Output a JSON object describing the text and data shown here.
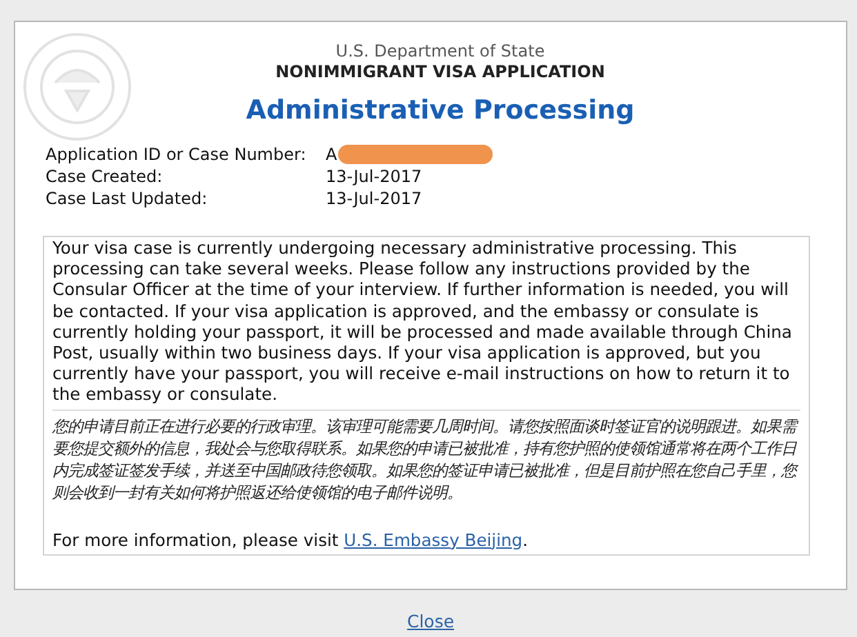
{
  "header": {
    "agency": "U.S. Department of State",
    "form": "NONIMMIGRANT VISA APPLICATION",
    "title": "Administrative Processing"
  },
  "case_info": [
    {
      "label": "Application ID or Case Number:",
      "value": "A",
      "redacted": true
    },
    {
      "label": "Case Created:",
      "value": "13-Jul-2017"
    },
    {
      "label": "Case Last Updated:",
      "value": "13-Jul-2017"
    }
  ],
  "message": {
    "english": "Your visa case is currently undergoing necessary administrative processing. This processing can take several weeks. Please follow any instructions provided by the Consular Officer at the time of your interview. If further information is needed, you will be contacted. If your visa application is approved, and the embassy or consulate is currently holding your passport, it will be processed and made available through China Post, usually within two business days. If your visa application is approved, but you currently have your passport, you will receive e-mail instructions on how to return it to the embassy or consulate.",
    "chinese": "您的申请目前正在进行必要的行政审理。该审理可能需要几周时间。请您按照面谈时签证官的说明跟进。如果需要您提交额外的信息，我处会与您取得联系。如果您的申请已被批准，持有您护照的使领馆通常将在两个工作日内完成签证签发手续，并送至中国邮政待您领取。如果您的签证申请已被批准，但是目前护照在您自己手里，您则会收到一封有关如何将护照返还给使领馆的电子邮件说明。",
    "more_info": "For more information, please visit",
    "link": "U.S. Embassy Beijing",
    "after_link": "."
  },
  "close": "Close"
}
